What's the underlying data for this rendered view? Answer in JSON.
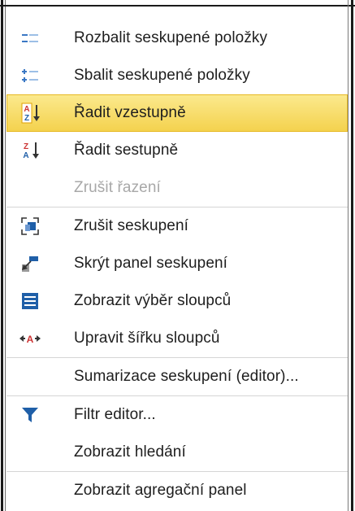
{
  "menu": {
    "items": [
      {
        "label": "Rozbalit seskupené položky",
        "icon": "expand-groups-icon"
      },
      {
        "label": "Sbalit seskupené položky",
        "icon": "collapse-groups-icon"
      },
      {
        "label": "Řadit vzestupně",
        "icon": "sort-ascending-icon",
        "highlighted": true
      },
      {
        "label": "Řadit sestupně",
        "icon": "sort-descending-icon"
      },
      {
        "label": "Zrušit řazení",
        "disabled": true
      },
      {
        "label": "Zrušit seskupení",
        "icon": "ungroup-icon"
      },
      {
        "label": "Skrýt panel seskupení",
        "icon": "hide-group-panel-icon"
      },
      {
        "label": "Zobrazit výběr sloupců",
        "icon": "column-chooser-icon"
      },
      {
        "label": "Upravit šířku sloupců",
        "icon": "best-fit-icon"
      },
      {
        "label": "Sumarizace seskupení (editor)..."
      },
      {
        "label": "Filtr editor...",
        "icon": "filter-icon"
      },
      {
        "label": "Zobrazit hledání"
      },
      {
        "label": "Zobrazit agregační panel"
      }
    ]
  },
  "colors": {
    "highlight": "#f6db6a",
    "icon_blue": "#1f5fa8",
    "disabled_text": "#a8a8a8"
  }
}
